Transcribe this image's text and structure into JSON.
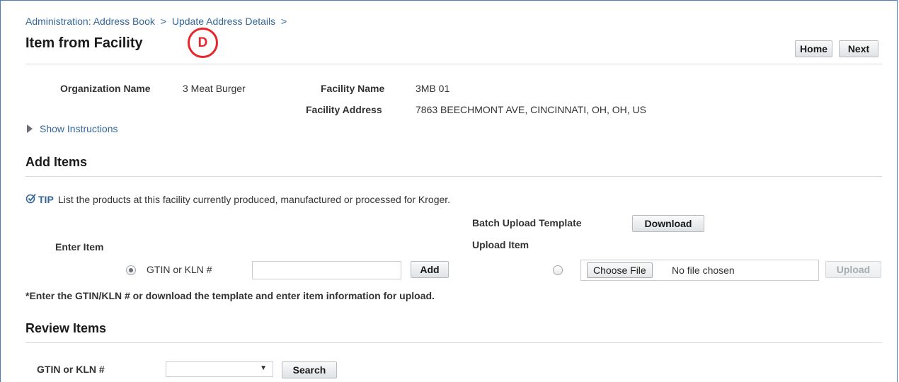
{
  "breadcrumb": {
    "item1": "Administration: Address Book",
    "sep1": ">",
    "item2": "Update Address Details",
    "sep2": ">"
  },
  "page_title": "Item from Facility",
  "marker_label": "D",
  "header_buttons": {
    "home": "Home",
    "next": "Next"
  },
  "facility_info": {
    "org_name_label": "Organization Name",
    "org_name_value": "3 Meat Burger",
    "facility_name_label": "Facility Name",
    "facility_name_value": "3MB 01",
    "facility_address_label": "Facility Address",
    "facility_address_value": "7863 BEECHMONT AVE, CINCINNATI, OH, OH, US"
  },
  "instructions_link": "Show Instructions",
  "add_items": {
    "title": "Add Items",
    "tip_label": "TIP",
    "tip_text": "List the products at this facility currently produced, manufactured or processed for Kroger.",
    "batch_template_label": "Batch Upload Template",
    "download_button": "Download",
    "enter_item_label": "Enter Item",
    "upload_item_label": "Upload Item",
    "gtin_radio_label": "GTIN or KLN #",
    "gtin_input_value": "",
    "add_button": "Add",
    "choose_file_button": "Choose File",
    "no_file_text": "No file chosen",
    "upload_button": "Upload",
    "note": "*Enter the GTIN/KLN # or download the template and enter item information for upload."
  },
  "review_items": {
    "title": "Review Items",
    "filter_label": "GTIN or KLN #",
    "filter_select_value": "",
    "search_button": "Search"
  },
  "colors": {
    "link": "#336699",
    "marker": "#e8252a",
    "frame": "#4a7cc0"
  }
}
